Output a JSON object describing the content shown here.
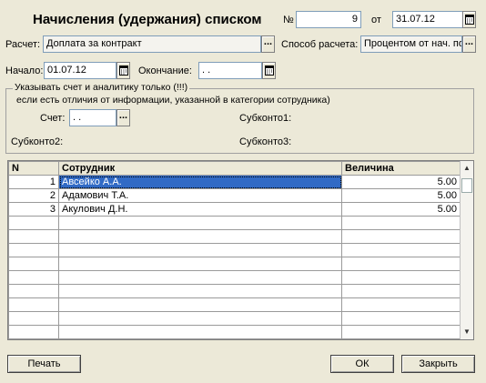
{
  "header": {
    "title": "Начисления (удержания) списком",
    "number_label": "№",
    "number_value": "9",
    "from_label": "от",
    "date_value": "31.07.12"
  },
  "calc": {
    "label": "Расчет:",
    "value": "Доплата за контракт",
    "method_label": "Способ расчета:",
    "method_value": "Процентом от нач. по"
  },
  "period": {
    "start_label": "Начало:",
    "start_value": "01.07.12",
    "end_label": "Окончание:",
    "end_value": " .  ."
  },
  "group": {
    "legend_line1": "Указывать счет и аналитику только (!!!)",
    "legend_line2": "если есть отличия от информации, указанной в категории сотрудника)",
    "account_label": "Счет:",
    "account_value": " .  .",
    "subconto1_label": "Субконто1:",
    "subconto2_label": "Субконто2:",
    "subconto3_label": "Субконто3:"
  },
  "grid": {
    "columns": [
      "N",
      "Сотрудник",
      "Величина"
    ],
    "rows": [
      {
        "n": "1",
        "employee": "Авсейко А.А.",
        "value": "5.00"
      },
      {
        "n": "2",
        "employee": "Адамович Т.А.",
        "value": "5.00"
      },
      {
        "n": "3",
        "employee": "Акулович Д.Н.",
        "value": "5.00"
      }
    ],
    "empty_rows": 9
  },
  "buttons": {
    "print": "Печать",
    "ok": "ОК",
    "close": "Закрыть",
    "ellipsis": "..."
  }
}
